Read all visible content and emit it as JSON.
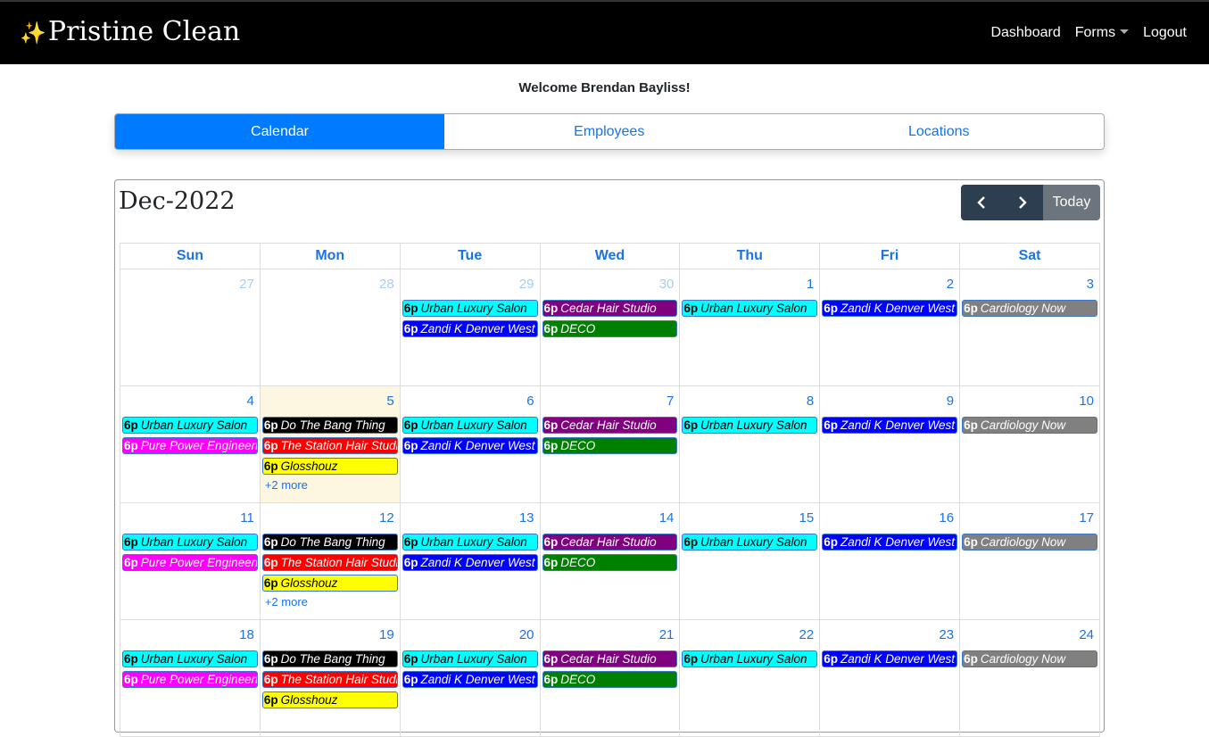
{
  "header": {
    "brand_icon": "✨",
    "brand": "Pristine Clean",
    "nav": {
      "dashboard": "Dashboard",
      "forms": "Forms",
      "logout": "Logout"
    }
  },
  "welcome": "Welcome Brendan Bayliss!",
  "tabs": [
    "Calendar",
    "Employees",
    "Locations"
  ],
  "calendar": {
    "title": "Dec-2022",
    "today_label": "Today",
    "weekdays": [
      "Sun",
      "Mon",
      "Tue",
      "Wed",
      "Thu",
      "Fri",
      "Sat"
    ],
    "colors": {
      "Urban Luxury Salon": "#00ffff",
      "Zandi K Denver West": "#0000ff",
      "Cedar Hair Studio": "#800080",
      "DECO": "#008000",
      "Cardiology Now": "#808080",
      "Do The Bang Thing": "#000000",
      "Pure Power Engineering": "#ff00ff",
      "The Station Hair Studio": "#ff0000",
      "Glosshouz": "#ffff00"
    },
    "weeks": [
      [
        {
          "day": "27",
          "other": true,
          "events": []
        },
        {
          "day": "28",
          "other": true,
          "events": []
        },
        {
          "day": "29",
          "other": true,
          "events": [
            {
              "time": "6p",
              "name": "Urban Luxury Salon"
            },
            {
              "time": "6p",
              "name": "Zandi K Denver West"
            }
          ]
        },
        {
          "day": "30",
          "other": true,
          "events": [
            {
              "time": "6p",
              "name": "Cedar Hair Studio"
            },
            {
              "time": "6p",
              "name": "DECO"
            }
          ]
        },
        {
          "day": "1",
          "events": [
            {
              "time": "6p",
              "name": "Urban Luxury Salon"
            }
          ]
        },
        {
          "day": "2",
          "events": [
            {
              "time": "6p",
              "name": "Zandi K Denver West"
            }
          ]
        },
        {
          "day": "3",
          "events": [
            {
              "time": "6p",
              "name": "Cardiology Now"
            }
          ]
        }
      ],
      [
        {
          "day": "4",
          "events": [
            {
              "time": "6p",
              "name": "Urban Luxury Salon"
            },
            {
              "time": "6p",
              "name": "Pure Power Engineering"
            }
          ]
        },
        {
          "day": "5",
          "today": true,
          "more": "+2 more",
          "events": [
            {
              "time": "6p",
              "name": "Do The Bang Thing"
            },
            {
              "time": "6p",
              "name": "The Station Hair Studio"
            },
            {
              "time": "6p",
              "name": "Glosshouz"
            }
          ]
        },
        {
          "day": "6",
          "events": [
            {
              "time": "6p",
              "name": "Urban Luxury Salon"
            },
            {
              "time": "6p",
              "name": "Zandi K Denver West"
            }
          ]
        },
        {
          "day": "7",
          "events": [
            {
              "time": "6p",
              "name": "Cedar Hair Studio"
            },
            {
              "time": "6p",
              "name": "DECO"
            }
          ]
        },
        {
          "day": "8",
          "events": [
            {
              "time": "6p",
              "name": "Urban Luxury Salon"
            }
          ]
        },
        {
          "day": "9",
          "events": [
            {
              "time": "6p",
              "name": "Zandi K Denver West"
            }
          ]
        },
        {
          "day": "10",
          "events": [
            {
              "time": "6p",
              "name": "Cardiology Now"
            }
          ]
        }
      ],
      [
        {
          "day": "11",
          "events": [
            {
              "time": "6p",
              "name": "Urban Luxury Salon"
            },
            {
              "time": "6p",
              "name": "Pure Power Engineering"
            }
          ]
        },
        {
          "day": "12",
          "more": "+2 more",
          "events": [
            {
              "time": "6p",
              "name": "Do The Bang Thing"
            },
            {
              "time": "6p",
              "name": "The Station Hair Studio"
            },
            {
              "time": "6p",
              "name": "Glosshouz"
            }
          ]
        },
        {
          "day": "13",
          "events": [
            {
              "time": "6p",
              "name": "Urban Luxury Salon"
            },
            {
              "time": "6p",
              "name": "Zandi K Denver West"
            }
          ]
        },
        {
          "day": "14",
          "events": [
            {
              "time": "6p",
              "name": "Cedar Hair Studio"
            },
            {
              "time": "6p",
              "name": "DECO"
            }
          ]
        },
        {
          "day": "15",
          "events": [
            {
              "time": "6p",
              "name": "Urban Luxury Salon"
            }
          ]
        },
        {
          "day": "16",
          "events": [
            {
              "time": "6p",
              "name": "Zandi K Denver West"
            }
          ]
        },
        {
          "day": "17",
          "events": [
            {
              "time": "6p",
              "name": "Cardiology Now"
            }
          ]
        }
      ],
      [
        {
          "day": "18",
          "events": [
            {
              "time": "6p",
              "name": "Urban Luxury Salon"
            },
            {
              "time": "6p",
              "name": "Pure Power Engineering"
            }
          ]
        },
        {
          "day": "19",
          "events": [
            {
              "time": "6p",
              "name": "Do The Bang Thing"
            },
            {
              "time": "6p",
              "name": "The Station Hair Studio"
            },
            {
              "time": "6p",
              "name": "Glosshouz"
            }
          ]
        },
        {
          "day": "20",
          "events": [
            {
              "time": "6p",
              "name": "Urban Luxury Salon"
            },
            {
              "time": "6p",
              "name": "Zandi K Denver West"
            }
          ]
        },
        {
          "day": "21",
          "events": [
            {
              "time": "6p",
              "name": "Cedar Hair Studio"
            },
            {
              "time": "6p",
              "name": "DECO"
            }
          ]
        },
        {
          "day": "22",
          "events": [
            {
              "time": "6p",
              "name": "Urban Luxury Salon"
            }
          ]
        },
        {
          "day": "23",
          "events": [
            {
              "time": "6p",
              "name": "Zandi K Denver West"
            }
          ]
        },
        {
          "day": "24",
          "events": [
            {
              "time": "6p",
              "name": "Cardiology Now"
            }
          ]
        }
      ]
    ]
  }
}
